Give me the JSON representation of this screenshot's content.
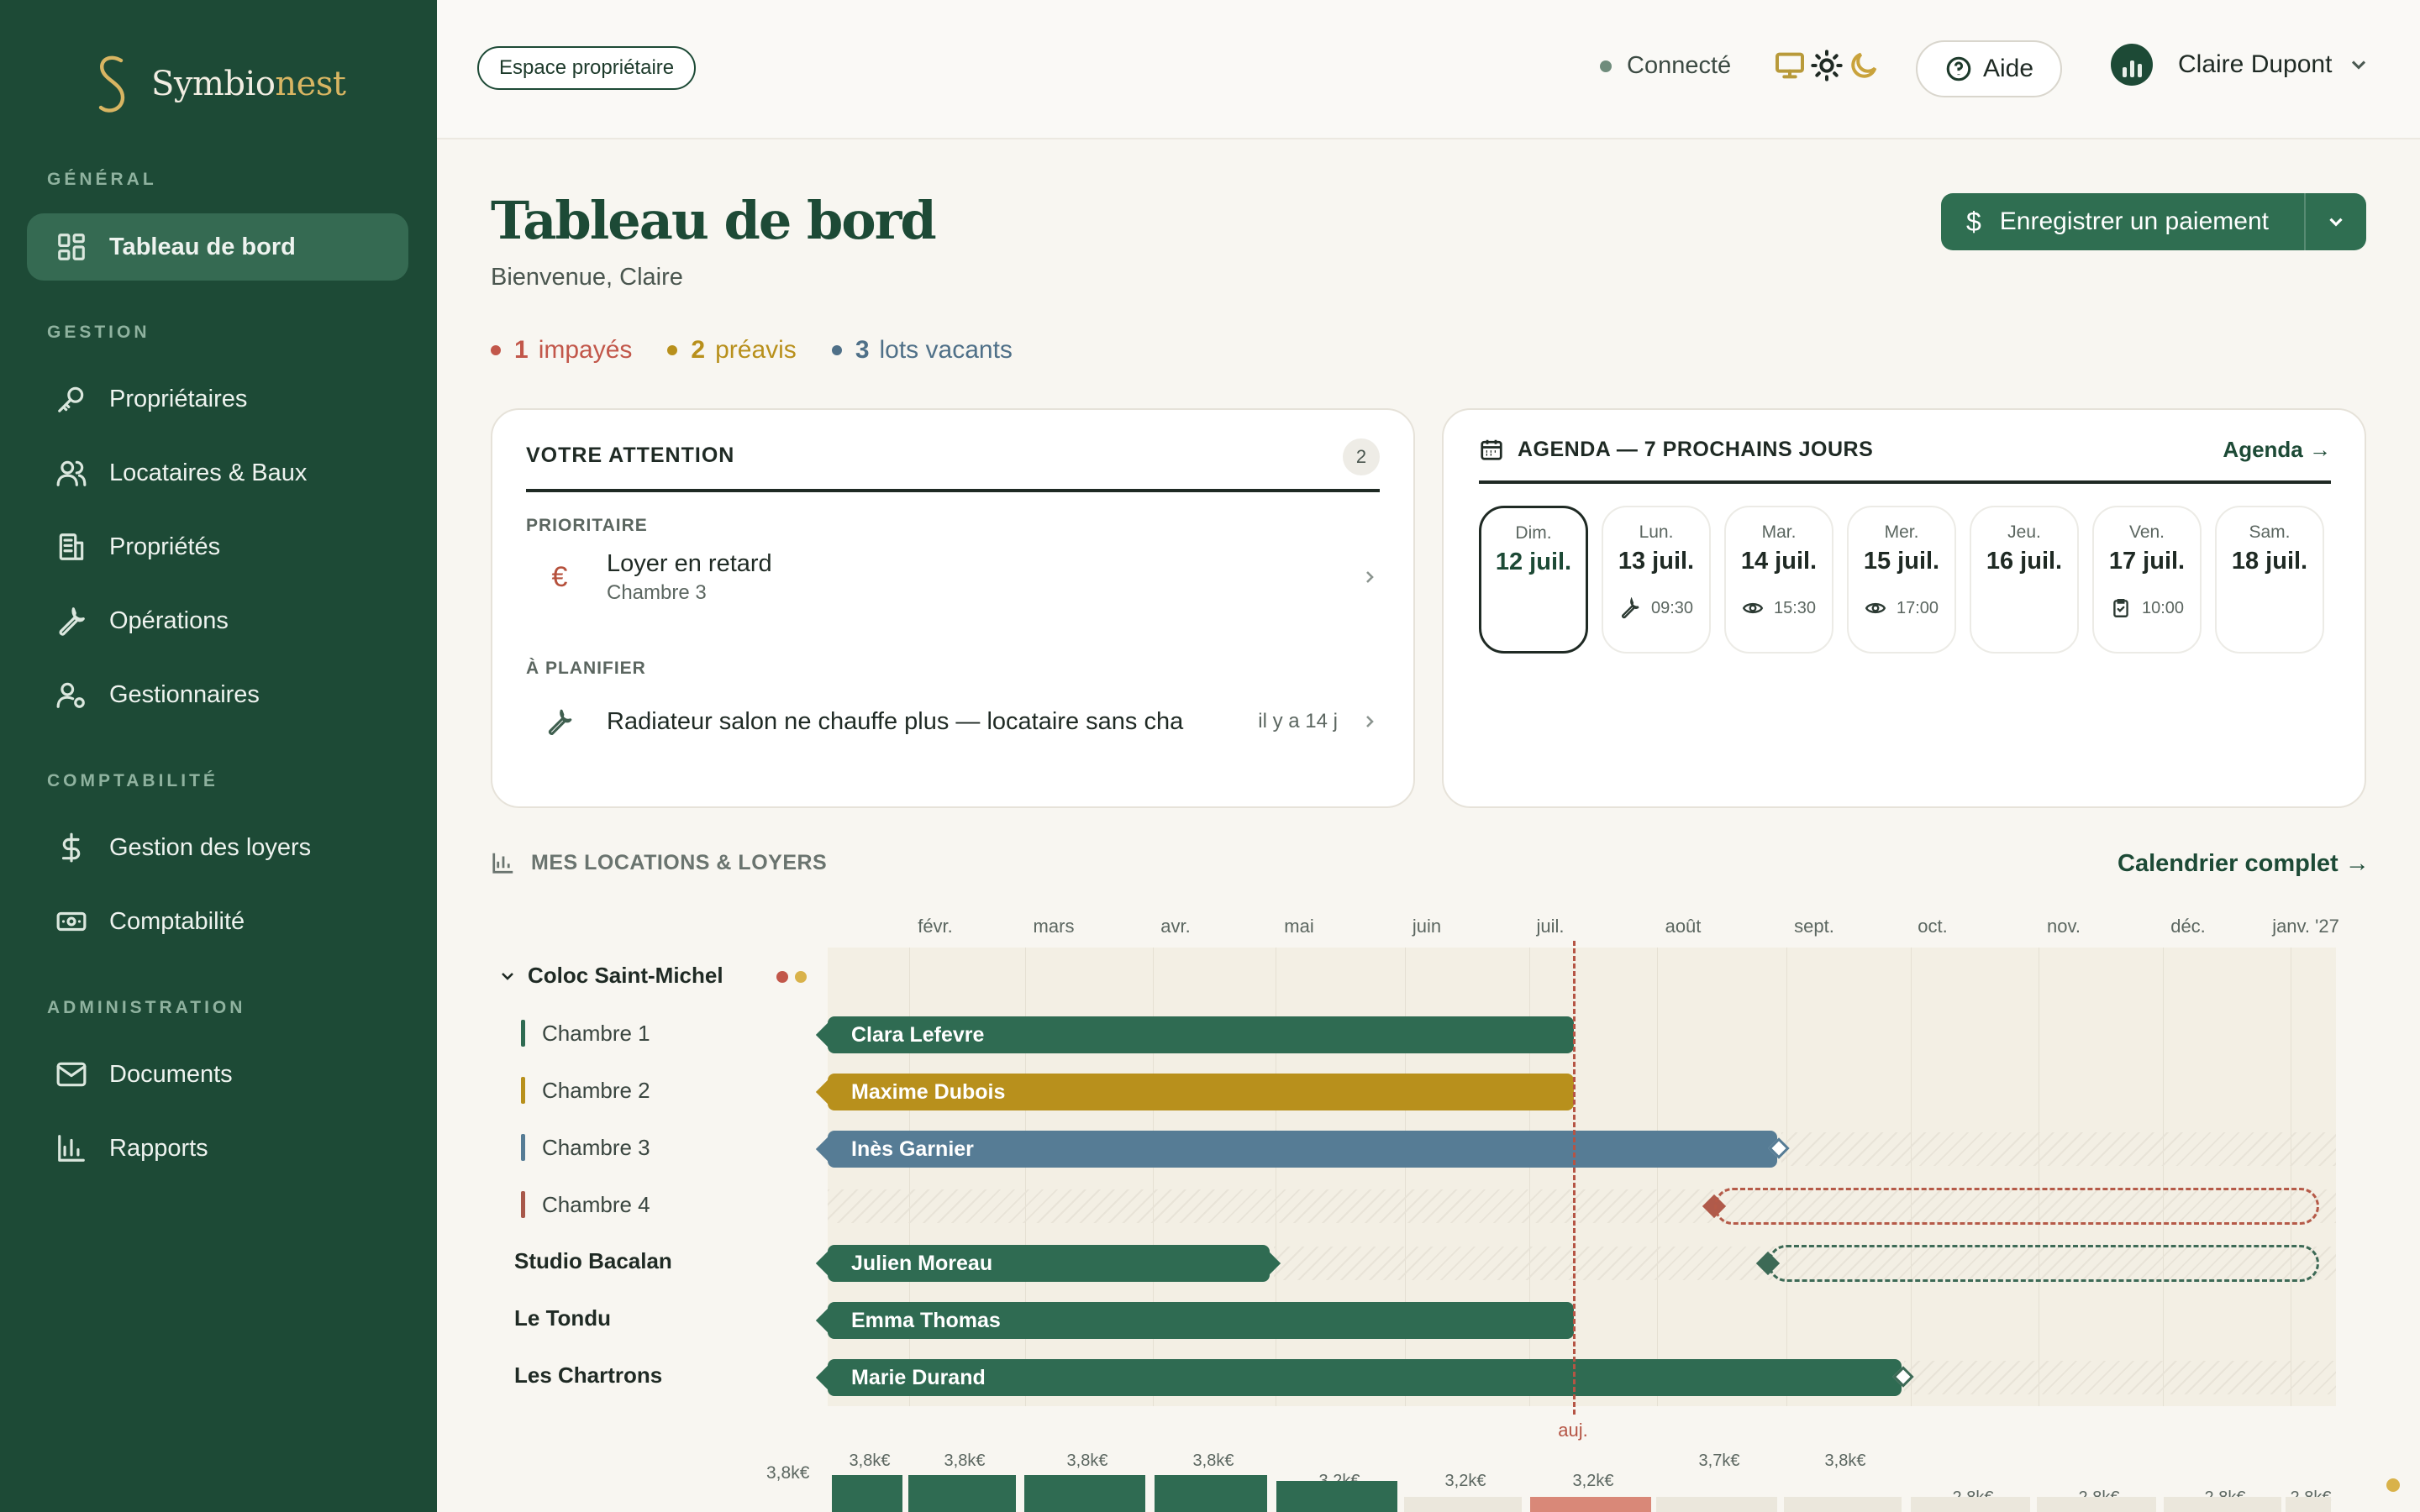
{
  "brand": {
    "name_a": "Symbio",
    "name_b": "nest"
  },
  "sidebar": {
    "sections": [
      {
        "label": "GÉNÉRAL"
      },
      {
        "label": "GESTION"
      },
      {
        "label": "COMPTABILITÉ"
      },
      {
        "label": "ADMINISTRATION"
      }
    ],
    "items": [
      {
        "label": "Tableau de bord",
        "icon": "grid-icon"
      },
      {
        "label": "Propriétaires",
        "icon": "key-icon"
      },
      {
        "label": "Locataires & Baux",
        "icon": "users-icon"
      },
      {
        "label": "Propriétés",
        "icon": "building-icon"
      },
      {
        "label": "Opérations",
        "icon": "wrench-icon"
      },
      {
        "label": "Gestionnaires",
        "icon": "user-gear-icon"
      },
      {
        "label": "Gestion des loyers",
        "icon": "dollar-icon"
      },
      {
        "label": "Comptabilité",
        "icon": "banknote-icon"
      },
      {
        "label": "Documents",
        "icon": "mail-icon"
      },
      {
        "label": "Rapports",
        "icon": "bar-chart-icon"
      }
    ]
  },
  "topbar": {
    "space_label": "Espace propriétaire",
    "status": "Connecté",
    "help": "Aide",
    "user_name": "Claire Dupont"
  },
  "header": {
    "title": "Tableau de bord",
    "subtitle": "Bienvenue, Claire",
    "pay_button": "Enregistrer un paiement",
    "counts": [
      {
        "n": "1",
        "label": "impayés",
        "color": "#c2574a"
      },
      {
        "n": "2",
        "label": "préavis",
        "color": "#b8901c"
      },
      {
        "n": "3",
        "label": "lots vacants",
        "color": "#4f7088"
      }
    ]
  },
  "attention": {
    "title": "VOTRE ATTENTION",
    "badge": "2",
    "priority_label": "PRIORITAIRE",
    "priority_item": {
      "title": "Loyer en retard",
      "sub": "Chambre 3",
      "icon": "€"
    },
    "plan_label": "À PLANIFIER",
    "plan_item": {
      "title": "Radiateur salon ne chauffe plus — locataire sans cha",
      "meta": "il y a 14 j"
    }
  },
  "agenda": {
    "title": "AGENDA — 7 PROCHAINS JOURS",
    "link": "Agenda →",
    "days": [
      {
        "name": "Dim.",
        "date": "12 juil.",
        "time": "",
        "icon": ""
      },
      {
        "name": "Lun.",
        "date": "13 juil.",
        "time": "09:30",
        "icon": "wrench-icon"
      },
      {
        "name": "Mar.",
        "date": "14 juil.",
        "time": "15:30",
        "icon": "eye-icon"
      },
      {
        "name": "Mer.",
        "date": "15 juil.",
        "time": "17:00",
        "icon": "eye-icon"
      },
      {
        "name": "Jeu.",
        "date": "16 juil.",
        "time": "",
        "icon": ""
      },
      {
        "name": "Ven.",
        "date": "17 juil.",
        "time": "10:00",
        "icon": "clipboard-icon"
      },
      {
        "name": "Sam.",
        "date": "18 juil.",
        "time": "",
        "icon": ""
      }
    ]
  },
  "rentals": {
    "title": "MES LOCATIONS & LOYERS",
    "link": "Calendrier complet →",
    "months": [
      "févr.",
      "mars",
      "avr.",
      "mai",
      "juin",
      "juil.",
      "août",
      "sept.",
      "oct.",
      "nov.",
      "déc.",
      "janv. '27"
    ],
    "today_label": "auj.",
    "rows": [
      {
        "label": "Coloc Saint-Michel",
        "kind": "group"
      },
      {
        "label": "Chambre 1",
        "kind": "sub",
        "color": "#2f6b52",
        "tenant": "Clara Lefevre"
      },
      {
        "label": "Chambre 2",
        "kind": "sub",
        "color": "#b8901c",
        "tenant": "Maxime Dubois"
      },
      {
        "label": "Chambre 3",
        "kind": "sub",
        "color": "#567c95",
        "tenant": "Inès Garnier"
      },
      {
        "label": "Chambre 4",
        "kind": "sub",
        "color": "#a8584a",
        "tenant": ""
      },
      {
        "label": "Studio Bacalan",
        "kind": "prop",
        "tenant": "Julien Moreau"
      },
      {
        "label": "Le Tondu",
        "kind": "prop",
        "tenant": "Emma Thomas"
      },
      {
        "label": "Les Chartrons",
        "kind": "prop",
        "tenant": "Marie Durand"
      }
    ],
    "revenue": {
      "axis_max": "3,8k€",
      "values": [
        "3,8k€",
        "3,8k€",
        "3,8k€",
        "3,8k€",
        "3,2k€",
        "3,2k€",
        "3,2k€",
        "3,7k€",
        "3,8k€",
        "2,8k€",
        "2,8k€",
        "2,8k€",
        "2,8k€"
      ]
    }
  }
}
